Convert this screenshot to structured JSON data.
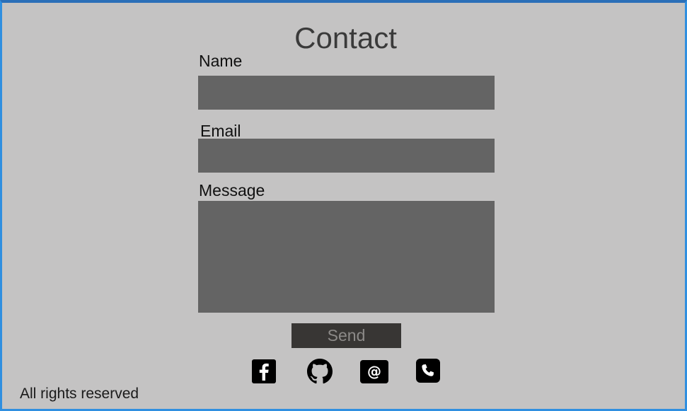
{
  "page": {
    "title": "Contact"
  },
  "form": {
    "name_label": "Name",
    "email_label": "Email",
    "message_label": "Message",
    "name_value": "",
    "email_value": "",
    "message_value": "",
    "send_label": "Send"
  },
  "social": [
    {
      "icon": "facebook-icon"
    },
    {
      "icon": "github-icon"
    },
    {
      "icon": "email-at-icon"
    },
    {
      "icon": "phone-icon"
    }
  ],
  "footer": {
    "text": "All rights reserved"
  },
  "colors": {
    "background": "#c4c3c3",
    "field": "#646464",
    "button": "#383634",
    "button_text": "#8c8a88",
    "border": "#2f8fe0"
  }
}
